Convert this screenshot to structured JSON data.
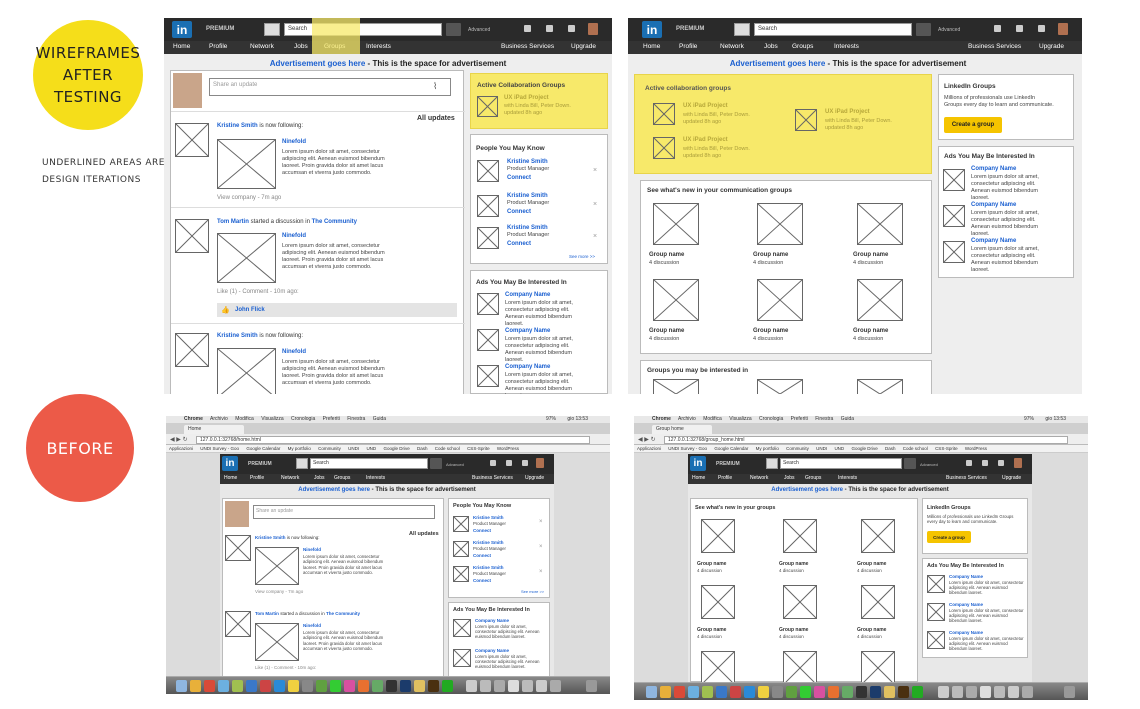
{
  "labels": {
    "wireframes": [
      "WIREFRAMES",
      "AFTER TESTING"
    ],
    "underlined_note": [
      "UNDERLINED AREAS ARE",
      "DESIGN ITERATIONS"
    ],
    "before": "BEFORE"
  },
  "colors": {
    "yellow": "#F5DE1A",
    "red": "#EC5A48",
    "linkedin_blue": "#1A6FB3",
    "highlight": "#F7E96A"
  },
  "nav": {
    "premium": "PREMIUM",
    "search_value": "Search",
    "advanced": "Advanced",
    "items": [
      "Home",
      "Profile",
      "Network",
      "Jobs",
      "Groups",
      "Interests"
    ],
    "right_items": [
      "Business Services",
      "Upgrade"
    ]
  },
  "ad": {
    "link": "Advertisement goes here",
    "rest": " - This is the space for advertisement"
  },
  "home": {
    "share_placeholder": "Share an update",
    "all_updates": "All updates",
    "feed": [
      {
        "user": "Kristine Smith",
        "action": "is now following:",
        "title": "Ninefold",
        "body": "Lorem ipsum dolor sit amet, consectetur adipiscing elit. Aenean euismod bibendum laoreet. Proin gravida dolor sit amet lacus accumsan et viverra justo commodo.",
        "meta": "View company - 7m ago"
      },
      {
        "user": "Tom Martin",
        "action": "started a discussion in",
        "group": "The Community",
        "title": "Ninefold",
        "body": "Lorem ipsum dolor sit amet, consectetur adipiscing elit. Aenean euismod bibendum laoreet. Proin gravida dolor sit amet lacus accumsan et viverra justo commodo.",
        "meta": "Like (1) - Comment - 10m ago:",
        "liker": "John Flick"
      },
      {
        "user": "Kristine Smith",
        "action": "is now following:",
        "title": "Ninefold",
        "body": "Lorem ipsum dolor sit amet, consectetur adipiscing elit. Aenean euismod bibendum laoreet. Proin gravida dolor sit amet lacus accumsan et viverra justo commodo."
      }
    ],
    "active_groups": {
      "title": "Active Collaboration Groups",
      "project": "UX iPad Project",
      "with": "with Linda Bill, Peter Down.",
      "updated": "updated 8h ago"
    },
    "people": {
      "title": "People You May Know",
      "name": "Kristine Smith",
      "role": "Product Manager",
      "connect": "Connect",
      "see_more": "See more >>"
    },
    "ads": {
      "title": "Ads You May Be Interested In",
      "company": "Company Name",
      "body": "Lorem ipsum dolor sit amet, consectetur adipiscing elit. Aenean euismod bibendum laoreet."
    }
  },
  "groups": {
    "active_title": "Active collaboration groups",
    "project": "UX iPad Project",
    "with": "with Linda Bill, Peter Down.",
    "updated": "updated 8h ago",
    "whats_new": "See what's new in your communication  groups",
    "whats_new_before": "See what's new in your groups",
    "group_name": "Group name",
    "discussion": "4 discussion",
    "may_like": "Groups you may be interested in",
    "linkedin_groups": "LinkedIn Groups",
    "lg_body": "Millions of professionals use LinkedIn Groups every day to learn and communicate.",
    "create": "Create a group",
    "ads_title": "Ads You May Be Interested In",
    "company": "Company Name",
    "ads_body": "Lorem ipsum dolor sit amet, consectetur adipiscing elit. Aenean euismod bibendum laoreet."
  },
  "browser": {
    "menu": [
      "Chrome",
      "Archivio",
      "Modifica",
      "Visualizza",
      "Cronologia",
      "Preferiti",
      "Finestra",
      "Guida"
    ],
    "clock": "gio 13:53",
    "battery": "97%",
    "tab_home": "Home",
    "tab_group": "Group home",
    "url_home": "127.0.0.1:32768/home.html",
    "url_group": "127.0.0.1:32768/group_home.html",
    "bookmarks": [
      "Applicazioni",
      "UNDI Survey - Goo",
      "Google Calendar",
      "My portfolio",
      "Community",
      "UNDI",
      "UND",
      "Google Drive",
      "Dash",
      "Code school",
      "CSS-Sprite",
      "WordPress"
    ]
  }
}
